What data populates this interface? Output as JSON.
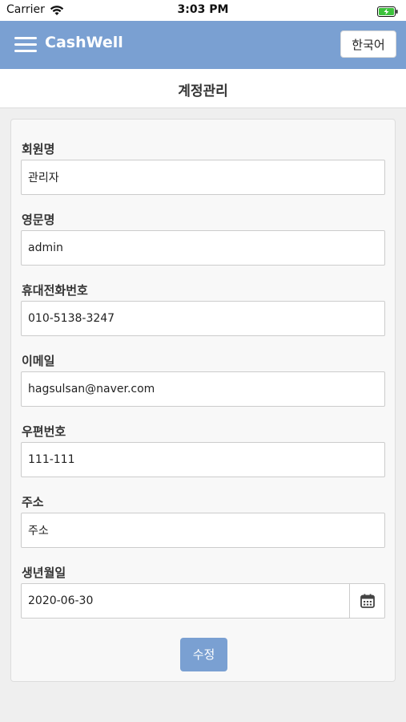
{
  "status_bar": {
    "carrier": "Carrier",
    "time": "3:03 PM"
  },
  "header": {
    "brand": "CashWell",
    "language_button": "한국어",
    "menu_icon": "hamburger-menu-icon"
  },
  "page": {
    "title": "계정관리"
  },
  "form": {
    "fields": [
      {
        "label": "회원명",
        "value": "관리자"
      },
      {
        "label": "영문명",
        "value": "admin"
      },
      {
        "label": "휴대전화번호",
        "value": "010-5138-3247"
      },
      {
        "label": "이메일",
        "value": "hagsulsan@naver.com"
      },
      {
        "label": "우편번호",
        "value": "111-111"
      },
      {
        "label": "주소",
        "value": "주소"
      },
      {
        "label": "생년월일",
        "value": "2020-06-30"
      }
    ],
    "calendar_icon": "calendar-icon",
    "submit_label": "수정"
  },
  "colors": {
    "accent": "#7aa0d2",
    "page_background": "#efefef",
    "card_background": "#f8f8f8"
  }
}
